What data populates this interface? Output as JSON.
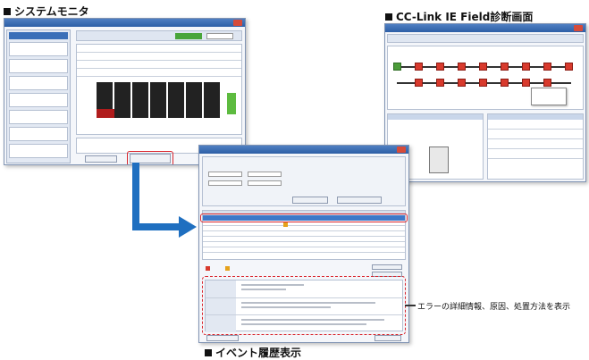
{
  "captions": {
    "system_monitor": "システムモニタ",
    "cclink": "CC-Link IE Field診断画面",
    "event_history": "イベント履歴表示"
  },
  "callout": {
    "text": "エラーの詳細情報、原因、処置方法を表示"
  },
  "colors": {
    "accent_red": "#d9262e",
    "arrow_blue": "#1f6fc0",
    "titlebar_blue": "#2d5fa6"
  },
  "icons": [
    "square-bullet-icon",
    "arrow-icon",
    "close-icon"
  ]
}
